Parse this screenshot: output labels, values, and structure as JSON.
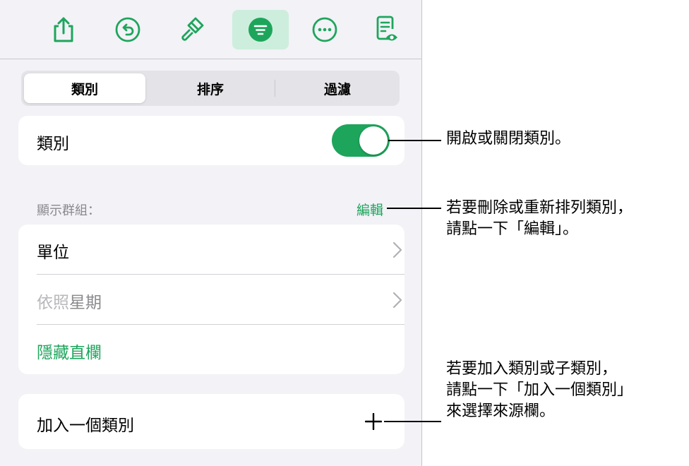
{
  "toolbar": {
    "buttons": [
      {
        "icon": "share-icon"
      },
      {
        "icon": "undo-icon"
      },
      {
        "icon": "format-brush-icon"
      },
      {
        "icon": "organize-icon",
        "active": true
      },
      {
        "icon": "more-icon"
      },
      {
        "icon": "reading-view-icon"
      }
    ]
  },
  "tabs": [
    {
      "label": "類別",
      "selected": true
    },
    {
      "label": "排序",
      "selected": false
    },
    {
      "label": "過濾",
      "selected": false
    }
  ],
  "categories_toggle": {
    "label": "類別",
    "on": true
  },
  "group_section": {
    "header": "顯示群組：",
    "edit_label": "編輯",
    "rows": [
      {
        "label": "單位"
      },
      {
        "label_prefix": "依照",
        "label_main": "星期"
      }
    ],
    "hide_columns_label": "隱藏直欄"
  },
  "add_category": {
    "label": "加入一個類別",
    "icon": "plus-icon"
  },
  "callouts": {
    "toggle": "開啟或關閉類別。",
    "edit": "若要刪除或重新排列類別，\n請點一下「編輯」。",
    "add": "若要加入類別或子類別，\n請點一下「加入一個類別」\n來選擇來源欄。"
  },
  "colors": {
    "accent": "#1ea55c",
    "accent_light": "#cdeedc",
    "panel_bg": "#f2f2f7"
  }
}
